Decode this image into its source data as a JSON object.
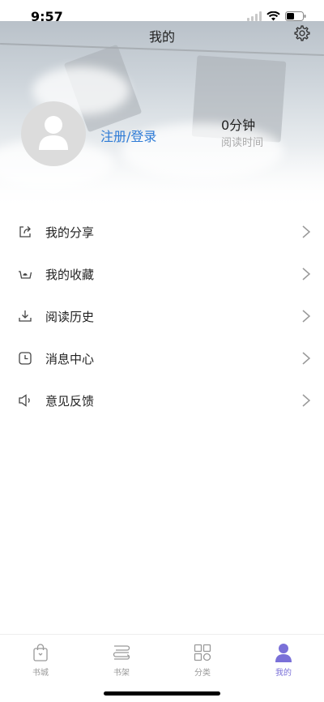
{
  "status_bar": {
    "time": "9:57"
  },
  "header": {
    "title": "我的"
  },
  "profile": {
    "login_label": "注册/登录",
    "read_time_value": "0分钟",
    "read_time_label": "阅读时间"
  },
  "menu": {
    "items": [
      {
        "label": "我的分享",
        "icon": "share-icon"
      },
      {
        "label": "我的收藏",
        "icon": "basket-icon"
      },
      {
        "label": "阅读历史",
        "icon": "download-icon"
      },
      {
        "label": "消息中心",
        "icon": "clock-icon"
      },
      {
        "label": "意见反馈",
        "icon": "speaker-icon"
      }
    ]
  },
  "tab_bar": {
    "tabs": [
      {
        "label": "书城",
        "icon": "shopping-bag-icon",
        "active": false
      },
      {
        "label": "书架",
        "icon": "bookshelf-icon",
        "active": false
      },
      {
        "label": "分类",
        "icon": "grid-icon",
        "active": false
      },
      {
        "label": "我的",
        "icon": "user-icon",
        "active": true
      }
    ]
  },
  "colors": {
    "accent": "#7a70d8",
    "link": "#2e7bd6"
  }
}
